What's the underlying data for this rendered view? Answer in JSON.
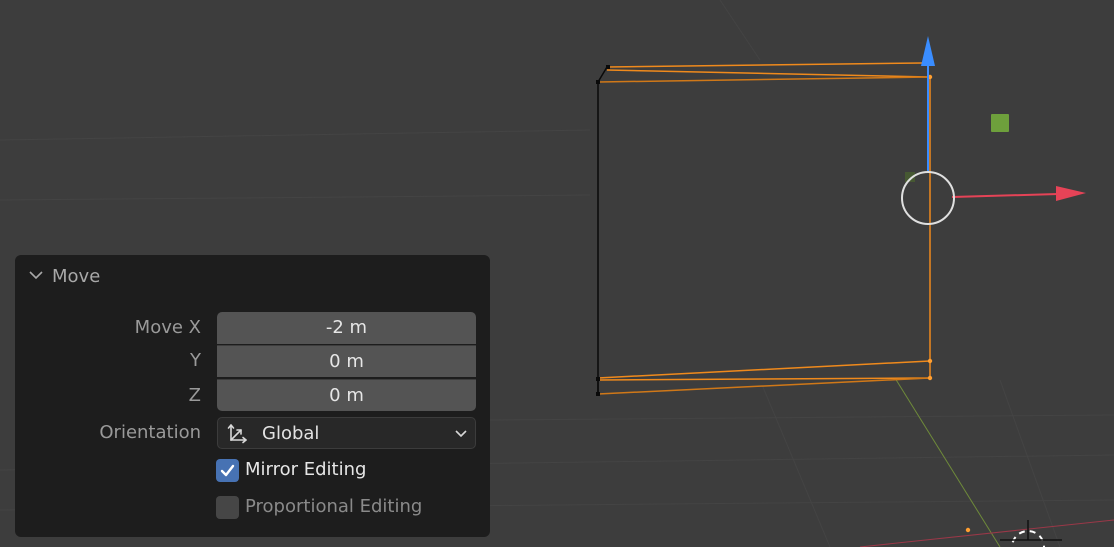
{
  "panel": {
    "title": "Move",
    "move_x_label": "Move X",
    "y_label": "Y",
    "z_label": "Z",
    "move_x_value": "-2 m",
    "move_y_value": "0 m",
    "move_z_value": "0 m",
    "orientation_label": "Orientation",
    "orientation_value": "Global",
    "mirror_editing": {
      "label": "Mirror Editing",
      "checked": true
    },
    "proportional_editing": {
      "label": "Proportional Editing",
      "checked": false
    }
  },
  "colors": {
    "viewport_bg": "#3d3d3d",
    "panel_bg": "#1d1d1d",
    "field_bg": "#545454",
    "checkbox_accent": "#4772b3",
    "selection_orange": "#f08a1c",
    "gizmo_z_blue": "#3a8dff",
    "gizmo_x_red": "#e64357",
    "gizmo_y_green": "#6ea03c"
  },
  "icons": {
    "panel_collapse": "chevron-down-icon",
    "orientation": "global-axes-icon",
    "dropdown": "chevron-down-icon",
    "checkbox": "checkmark-icon"
  }
}
